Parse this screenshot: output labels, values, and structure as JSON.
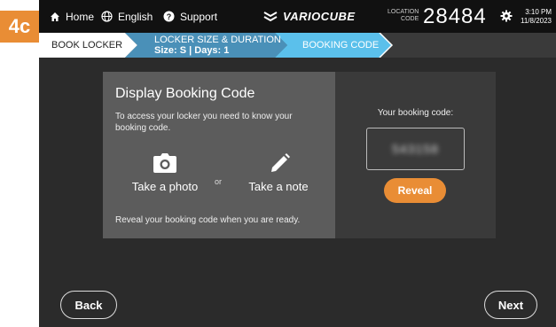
{
  "step_tag": "4c",
  "topbar": {
    "home_label": "Home",
    "language_label": "English",
    "support_label": "Support",
    "brand": "VARIOCUBE",
    "location_label_1": "LOCATION",
    "location_label_2": "CODE",
    "location_code": "28484",
    "time": "3:10 PM",
    "date": "11/8/2023"
  },
  "breadcrumb": {
    "step1": "BOOK LOCKER",
    "step2_title": "LOCKER SIZE & DURATION",
    "step2_detail": "Size: S | Days: 1",
    "step3": "BOOKING CODE"
  },
  "card": {
    "title": "Display Booking Code",
    "description": "To access your locker you need to know your booking code.",
    "option_photo": "Take a photo",
    "or_label": "or",
    "option_note": "Take a note",
    "footer": "Reveal your booking code when you are ready."
  },
  "code_panel": {
    "label": "Your booking code:",
    "masked_code": "543158",
    "reveal_label": "Reveal"
  },
  "nav": {
    "back_label": "Back",
    "next_label": "Next"
  },
  "colors": {
    "accent": "#e98d35",
    "crumb_active": "#4a90b8",
    "crumb_current": "#5bc0eb"
  }
}
